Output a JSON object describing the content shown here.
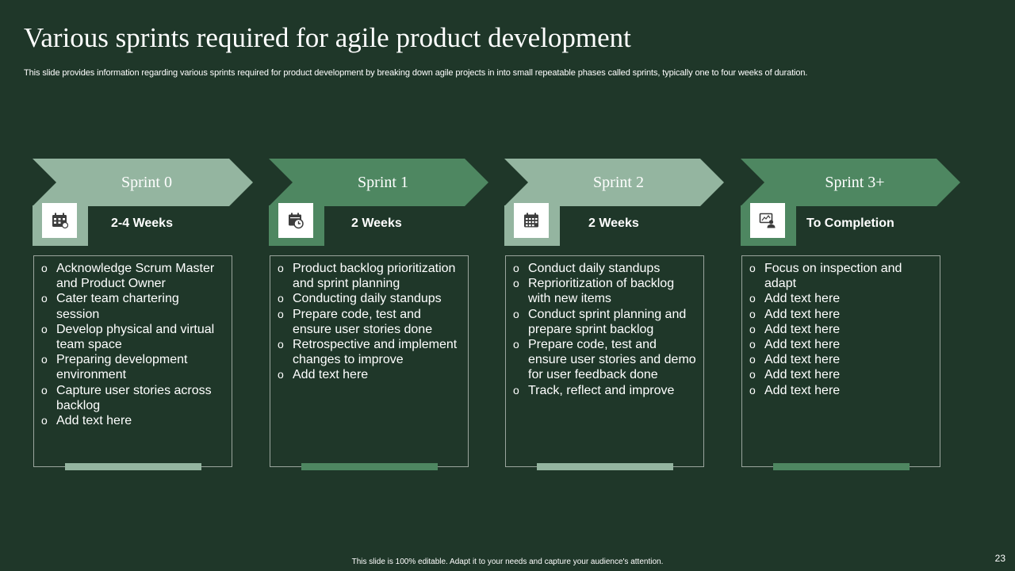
{
  "title": "Various sprints required for agile product development",
  "subtitle": "This slide provides information regarding various sprints required for product development by breaking down agile projects in into small repeatable phases called sprints, typically one to four weeks of duration.",
  "colors": {
    "background": "#1f3729",
    "light_green": "#94b5a0",
    "medium_green": "#4e8761"
  },
  "sprints": [
    {
      "name": "Sprint 0",
      "duration": "2-4 Weeks",
      "icon": "calendar-schedule-icon",
      "items": [
        "Acknowledge Scrum Master and  Product Owner",
        "Cater team chartering session",
        "Develop physical and virtual team space",
        "Preparing development environment",
        "Capture user stories across backlog",
        "Add text here"
      ]
    },
    {
      "name": "Sprint 1",
      "duration": "2 Weeks",
      "icon": "calendar-clock-icon",
      "items": [
        "Product backlog prioritization and sprint planning",
        "Conducting daily standups",
        "Prepare code, test and ensure user stories done",
        "Retrospective and implement changes  to improve",
        "Add text here"
      ]
    },
    {
      "name": "Sprint 2",
      "duration": "2 Weeks",
      "icon": "calendar-grid-icon",
      "items": [
        "Conduct daily standups",
        "Reprioritization of backlog with new items",
        "Conduct sprint planning and prepare sprint backlog",
        "Prepare code, test and ensure user stories and demo for user feedback done",
        "Track, reflect and improve"
      ]
    },
    {
      "name": "Sprint 3+",
      "duration": "To Completion",
      "icon": "screen-user-icon",
      "items": [
        "Focus on inspection and adapt",
        "Add text here",
        "Add text here",
        "Add text here",
        "Add text here",
        "Add text here",
        "Add text here",
        "Add text here"
      ]
    }
  ],
  "footer": "This slide is 100% editable.  Adapt it to your needs and capture your audience's attention.",
  "page_number": "23"
}
